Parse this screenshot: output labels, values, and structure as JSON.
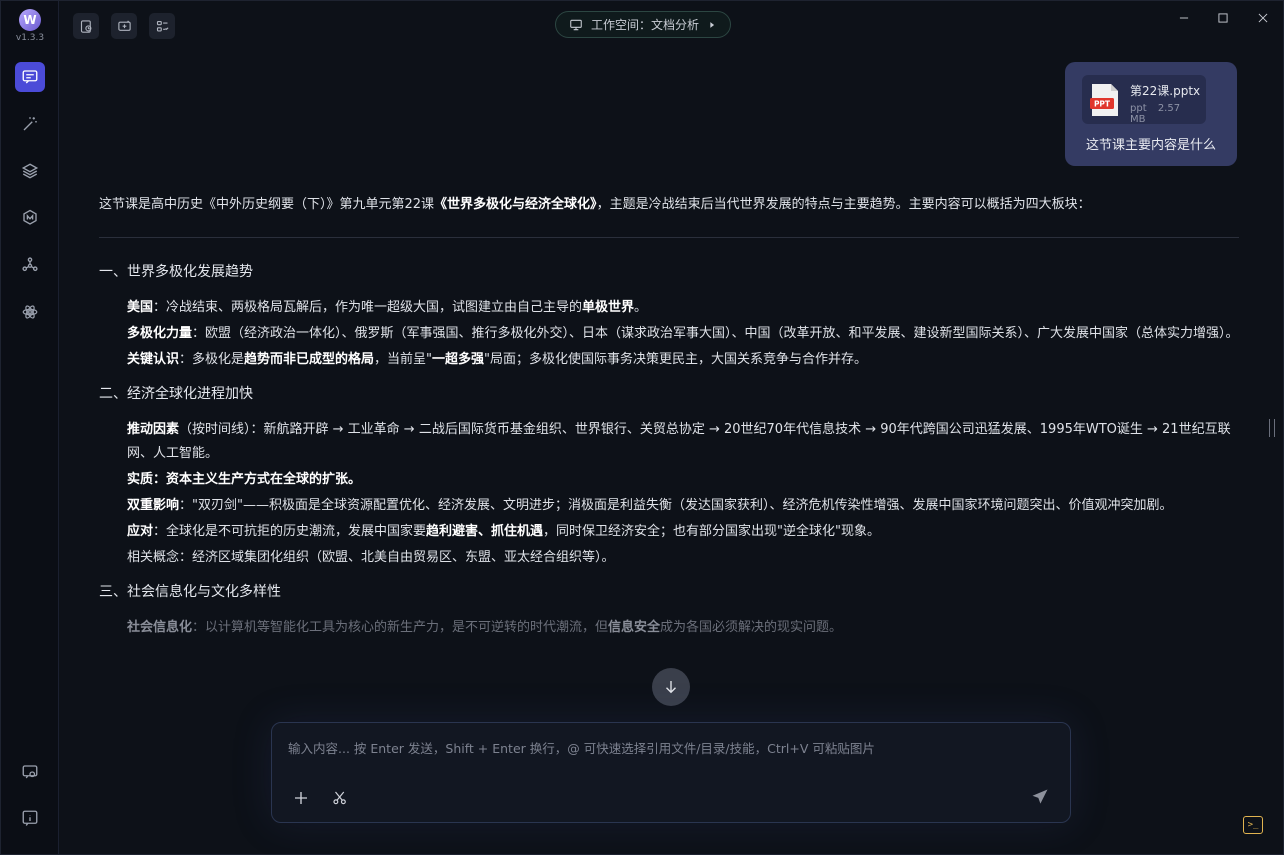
{
  "app": {
    "version": "v1.3.3",
    "workspace_label": "工作空间：文档分析"
  },
  "sidebar": {
    "items": [
      {
        "name": "chat",
        "icon": "chat-icon",
        "active": true
      },
      {
        "name": "magic",
        "icon": "magic-wand-icon",
        "active": false
      },
      {
        "name": "layers",
        "icon": "layers-icon",
        "active": false
      },
      {
        "name": "model",
        "icon": "model-hex-icon",
        "active": false
      },
      {
        "name": "network",
        "icon": "network-icon",
        "active": false
      },
      {
        "name": "atom",
        "icon": "atom-icon",
        "active": false
      }
    ],
    "bottom": [
      {
        "name": "settings",
        "icon": "settings-chat-icon"
      },
      {
        "name": "info",
        "icon": "info-icon"
      }
    ]
  },
  "message": {
    "file_name": "第22课.pptx",
    "file_type": "ppt",
    "file_size": "2.57 MB",
    "file_badge": "PPT",
    "text": "这节课主要内容是什么"
  },
  "answer": {
    "intro_pre": "这节课是高中历史《中外历史纲要（下）》第九单元第22课",
    "intro_bold": "《世界多极化与经济全球化》",
    "intro_post": "，主题是冷战结束后当代世界发展的特点与主要趋势。主要内容可以概括为四大板块：",
    "s1_title": "一、世界多极化发展趋势",
    "s1_i1_label": "美国",
    "s1_i1_text": "：冷战结束、两极格局瓦解后，作为唯一超级大国，试图建立由自己主导的",
    "s1_i1_bold": "单极世界",
    "s1_i1_end": "。",
    "s1_i2_label": "多极化力量",
    "s1_i2_text": "：欧盟（经济政治一体化）、俄罗斯（军事强国、推行多极化外交）、日本（谋求政治军事大国）、中国（改革开放、和平发展、建设新型国际关系）、广大发展中国家（总体实力增强）。",
    "s1_i3_label": "关键认识",
    "s1_i3_a": "：多极化是",
    "s1_i3_b": "趋势而非已成型的格局",
    "s1_i3_c": "，当前呈\"",
    "s1_i3_d": "一超多强",
    "s1_i3_e": "\"局面；多极化使国际事务决策更民主，大国关系竞争与合作并存。",
    "s2_title": "二、经济全球化进程加快",
    "s2_i1_label": "推动因素",
    "s2_i1_text": "（按时间线）：新航路开辟 → 工业革命 → 二战后国际货币基金组织、世界银行、关贸总协定 → 20世纪70年代信息技术 → 90年代跨国公司迅猛发展、1995年WTO诞生 → 21世纪互联网、人工智能。",
    "s2_i2_label": "实质",
    "s2_i2_text": "：资本主义生产方式在全球的扩张。",
    "s2_i3_label": "双重影响",
    "s2_i3_text": "：\"双刃剑\"——积极面是全球资源配置优化、经济发展、文明进步；消极面是利益失衡（发达国家获利）、经济危机传染性增强、发展中国家环境问题突出、价值观冲突加剧。",
    "s2_i4_label": "应对",
    "s2_i4_a": "：全球化是不可抗拒的历史潮流，发展中国家要",
    "s2_i4_b": "趋利避害、抓住机遇",
    "s2_i4_c": "，同时保卫经济安全；也有部分国家出现\"逆全球化\"现象。",
    "s2_i5_text": "相关概念：经济区域集团化组织（欧盟、北美自由贸易区、东盟、亚太经合组织等）。",
    "s3_title": "三、社会信息化与文化多样性",
    "s3_i1_label": "社会信息化",
    "s3_i1_a": "：以计算机等智能化工具为核心的新生产力，是不可逆转的时代潮流，但",
    "s3_i1_b": "信息安全",
    "s3_i1_c": "成为各国必须解决的现实问题。"
  },
  "composer": {
    "placeholder": "输入内容... 按 Enter 发送，Shift + Enter 换行，@ 可快速选择引用文件/目录/技能，Ctrl+V 可粘贴图片",
    "value": ""
  },
  "colors": {
    "accent": "#4b4bd8",
    "bubble": "#343b63",
    "terminal": "#e0b350"
  }
}
